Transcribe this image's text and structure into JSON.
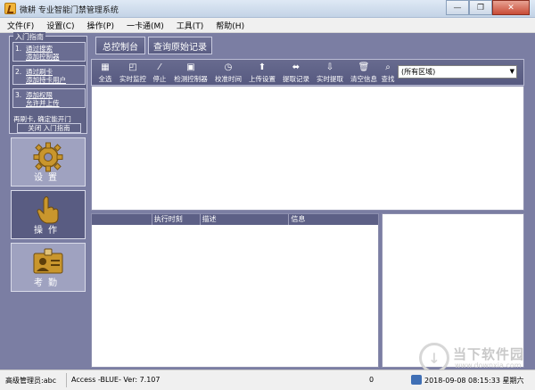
{
  "window": {
    "title": "微耕 专业智能门禁管理系统",
    "minimize_label": "—",
    "restore_label": "❐",
    "close_label": "✕"
  },
  "menu": [
    "文件(F)",
    "设置(C)",
    "操作(P)",
    "一卡通(M)",
    "工具(T)",
    "帮助(H)"
  ],
  "guide": {
    "title": "入门指南",
    "steps": [
      {
        "num": "1.",
        "text": "通过搜索\n添加控制器"
      },
      {
        "num": "2.",
        "text": "通过刷卡\n添加持卡用户"
      },
      {
        "num": "3.",
        "text": "添加权限\n允许并上传"
      }
    ],
    "note": "再刷卡, 确定能开门",
    "close": "关闭 入门指南"
  },
  "nav": {
    "settings": "设置",
    "operate": "操作",
    "attendance": "考勤"
  },
  "tabs": {
    "console": "总控制台",
    "query_records": "查询原始记录"
  },
  "toolbar": {
    "select_all": "全选",
    "realtime_monitor": "实时监控",
    "stop": "停止",
    "check_controller": "检测控制器",
    "calibrate_time": "校准时间",
    "upload_settings": "上传设置",
    "fetch_records": "提取记录",
    "realtime_fetch": "实时提取",
    "clear_info": "清空信息",
    "search": "查找"
  },
  "area_select": {
    "value": "(所有区域)"
  },
  "log_table": {
    "columns": [
      "",
      "执行时刻",
      "描述",
      "信息"
    ]
  },
  "status": {
    "user": "高级管理员:abc",
    "db": "Access -BLUE- Ver: 7.107",
    "count": "0",
    "datetime": "2018-09-08 08:15:33 星期六"
  },
  "watermark": {
    "mark": "↓",
    "text": "当下软件园",
    "url": "www.downxia.com"
  }
}
